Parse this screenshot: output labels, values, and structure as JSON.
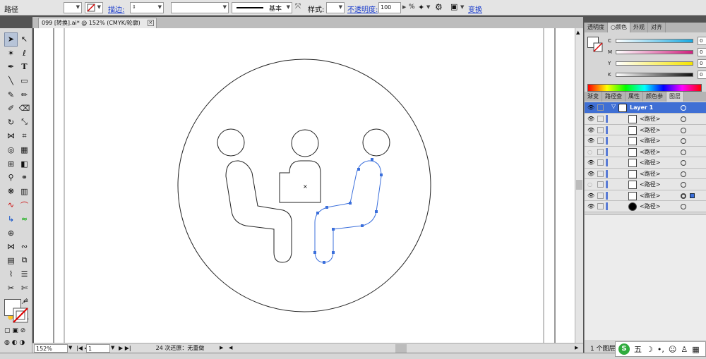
{
  "control_bar": {
    "object_type": "路径",
    "stroke_label": "描边:",
    "stroke_style": "基本",
    "style_label": "样式:",
    "opacity_label": "不透明度:",
    "opacity_value": "100",
    "opacity_unit": "%",
    "transform_label": "变换"
  },
  "document_tab": {
    "title": "099 [转换].ai* @ 152% (CMYK/轮廓)",
    "close": "×"
  },
  "status_bar": {
    "zoom": "152%",
    "artboard": "1",
    "undo_text": "24 次还原：无重做"
  },
  "panel_tabs_top": [
    "透明度",
    "○颜色",
    "外观",
    "对齐"
  ],
  "color_sliders": [
    {
      "channel": "C",
      "value": "0",
      "color": "#18a8e0"
    },
    {
      "channel": "M",
      "value": "0",
      "color": "#d0207f"
    },
    {
      "channel": "Y",
      "value": "0",
      "color": "#f5e400"
    },
    {
      "channel": "K",
      "value": "0",
      "color": "#111111"
    }
  ],
  "color_unit": "%",
  "panel_tabs_bottom": [
    "渐变",
    "路径查",
    "属性",
    "颜色参",
    "图层"
  ],
  "layers": {
    "parent": "Layer 1",
    "children": [
      "<路径>",
      "<路径>",
      "<路径>",
      "<路径>",
      "<路径>",
      "<路径>",
      "<路径>",
      "<路径>",
      "<路径>"
    ],
    "footer": "1 个图层"
  },
  "ime": {
    "char": "五"
  },
  "colors": {
    "selection": "#3b6fdb",
    "layer_accent": "#5a7cd6",
    "layer_header": "#3f6fd4"
  }
}
